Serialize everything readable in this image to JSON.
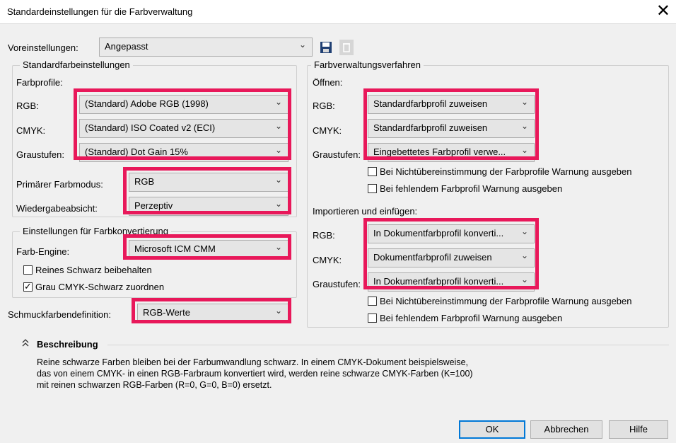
{
  "window": {
    "title": "Standardeinstellungen für die Farbverwaltung",
    "close_symbol": "✕"
  },
  "presets": {
    "label": "Voreinstellungen:",
    "value": "Angepasst"
  },
  "std": {
    "legend": "Standardfarbeinstellungen",
    "profiles_label": "Farbprofile:",
    "rgb_label": "RGB:",
    "rgb_value": "(Standard) Adobe RGB (1998)",
    "cmyk_label": "CMYK:",
    "cmyk_value": "(Standard) ISO Coated v2 (ECI)",
    "gray_label": "Graustufen:",
    "gray_value": "(Standard) Dot Gain 15%",
    "primary_label": "Primärer Farbmodus:",
    "primary_value": "RGB",
    "intent_label": "Wiedergabeabsicht:",
    "intent_value": "Perzeptiv"
  },
  "conv": {
    "legend": "Einstellungen für Farbkonvertierung",
    "engine_label": "Farb-Engine:",
    "engine_value": "Microsoft ICM CMM",
    "pure_black_label": "Reines Schwarz beibehalten",
    "pure_black_checked": false,
    "gray_map_label": "Grau CMYK-Schwarz zuordnen",
    "gray_map_checked": true
  },
  "spot": {
    "label": "Schmuckfarbendefinition:",
    "value": "RGB-Werte"
  },
  "policy": {
    "legend": "Farbverwaltungsverfahren",
    "open_label": "Öffnen:",
    "open_rgb_label": "RGB:",
    "open_rgb_value": "Standardfarbprofil zuweisen",
    "open_cmyk_label": "CMYK:",
    "open_cmyk_value": "Standardfarbprofil zuweisen",
    "open_gray_label": "Graustufen:",
    "open_gray_value": "Eingebettetes Farbprofil verwe...",
    "open_mismatch_label": "Bei Nichtübereinstimmung der Farbprofile Warnung ausgeben",
    "open_missing_label": "Bei fehlendem Farbprofil Warnung ausgeben",
    "import_label": "Importieren und einfügen:",
    "imp_rgb_label": "RGB:",
    "imp_rgb_value": "In Dokumentfarbprofil konverti...",
    "imp_cmyk_label": "CMYK:",
    "imp_cmyk_value": "Dokumentfarbprofil zuweisen",
    "imp_gray_label": "Graustufen:",
    "imp_gray_value": "In Dokumentfarbprofil konverti...",
    "imp_mismatch_label": "Bei Nichtübereinstimmung der Farbprofile Warnung ausgeben",
    "imp_missing_label": "Bei fehlendem Farbprofil Warnung ausgeben"
  },
  "description": {
    "heading": "Beschreibung",
    "lines": [
      "Reine schwarze Farben bleiben bei der Farbumwandlung schwarz. In einem CMYK-Dokument beispielsweise,",
      "das von einem CMYK- in einen RGB-Farbraum konvertiert wird, werden reine schwarze CMYK-Farben (K=100)",
      "mit reinen schwarzen RGB-Farben (R=0, G=0, B=0) ersetzt."
    ]
  },
  "buttons": {
    "ok": "OK",
    "cancel": "Abbrechen",
    "help": "Hilfe"
  },
  "icons": {
    "save": "save-icon",
    "delete": "delete-icon",
    "chevron": "⌵",
    "collapse": "⌃"
  },
  "colors": {
    "highlight": "#e8185a",
    "default_button": "#0078d7"
  }
}
